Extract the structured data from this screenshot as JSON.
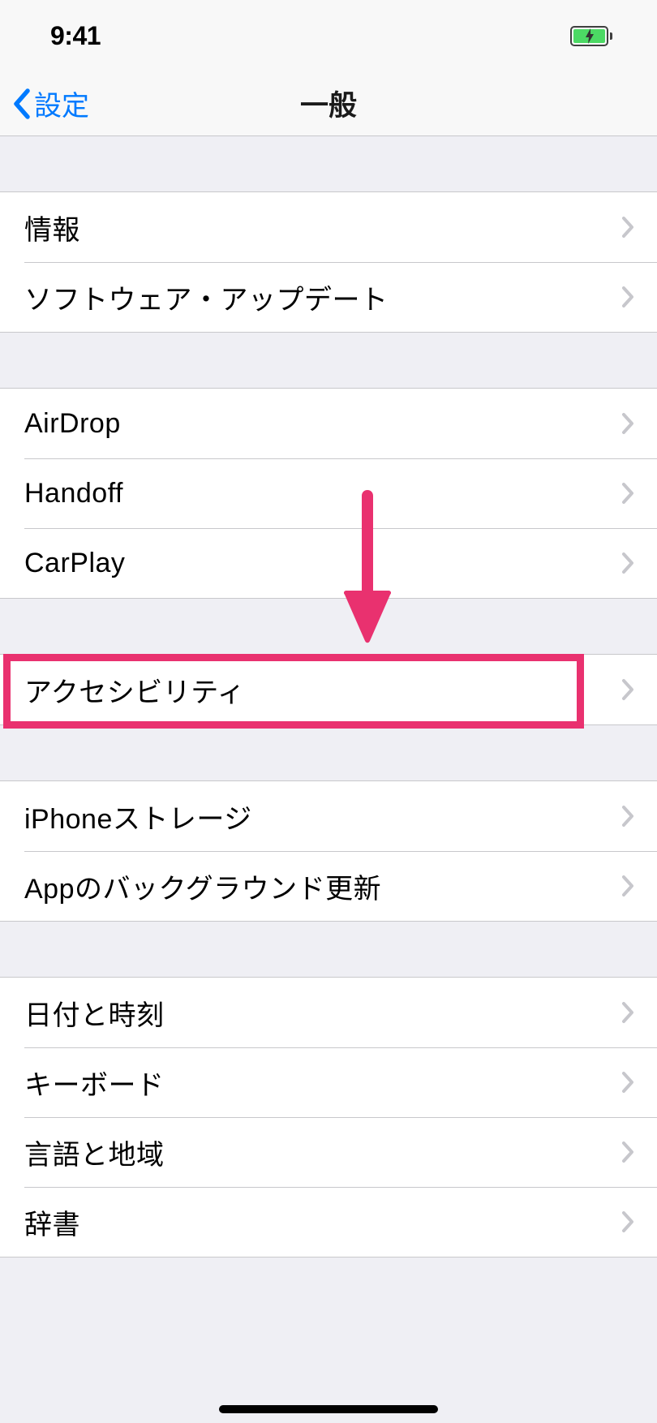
{
  "status_bar": {
    "time": "9:41"
  },
  "nav": {
    "back_label": "設定",
    "title": "一般"
  },
  "groups": [
    {
      "rows": [
        {
          "label": "情報",
          "name": "about"
        },
        {
          "label": "ソフトウェア・アップデート",
          "name": "software-update"
        }
      ]
    },
    {
      "rows": [
        {
          "label": "AirDrop",
          "name": "airdrop"
        },
        {
          "label": "Handoff",
          "name": "handoff"
        },
        {
          "label": "CarPlay",
          "name": "carplay"
        }
      ]
    },
    {
      "rows": [
        {
          "label": "アクセシビリティ",
          "name": "accessibility"
        }
      ]
    },
    {
      "rows": [
        {
          "label": "iPhoneストレージ",
          "name": "iphone-storage"
        },
        {
          "label": "Appのバックグラウンド更新",
          "name": "background-app-refresh"
        }
      ]
    },
    {
      "rows": [
        {
          "label": "日付と時刻",
          "name": "date-time"
        },
        {
          "label": "キーボード",
          "name": "keyboard"
        },
        {
          "label": "言語と地域",
          "name": "language-region"
        },
        {
          "label": "辞書",
          "name": "dictionary"
        }
      ]
    }
  ],
  "annotation": {
    "arrow_color": "#e9316f",
    "highlight_color": "#e9316f"
  }
}
